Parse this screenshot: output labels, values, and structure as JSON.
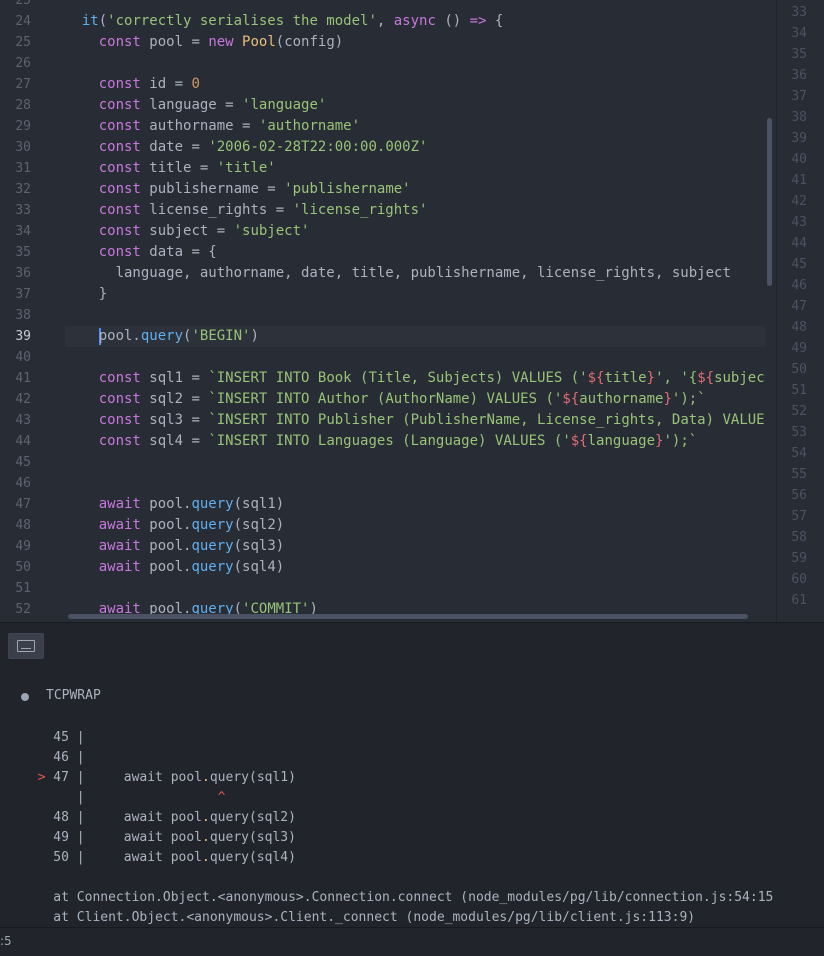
{
  "editor": {
    "gutter": [
      "25",
      "24",
      "25",
      "26",
      "27",
      "28",
      "29",
      "30",
      "31",
      "32",
      "33",
      "34",
      "35",
      "36",
      "37",
      "38",
      "39",
      "40",
      "41",
      "42",
      "43",
      "44",
      "45",
      "46",
      "47",
      "48",
      "49",
      "50",
      "51",
      "52"
    ],
    "active_line": "39",
    "lines": [
      [],
      [
        [
          "  ",
          ""
        ],
        [
          "it",
          "f"
        ],
        [
          "(",
          ""
        ],
        [
          "'correctly serialises the model'",
          "s"
        ],
        [
          ", ",
          ""
        ],
        [
          "async",
          "k"
        ],
        [
          " () ",
          ""
        ],
        [
          "=>",
          "k"
        ],
        [
          " {",
          ""
        ]
      ],
      [
        [
          "    ",
          ""
        ],
        [
          "const",
          "k"
        ],
        [
          " pool = ",
          ""
        ],
        [
          "new",
          "k"
        ],
        [
          " ",
          ""
        ],
        [
          "Pool",
          "c"
        ],
        [
          "(config)",
          ""
        ]
      ],
      [],
      [
        [
          "    ",
          ""
        ],
        [
          "const",
          "k"
        ],
        [
          " id = ",
          ""
        ],
        [
          "0",
          "n"
        ]
      ],
      [
        [
          "    ",
          ""
        ],
        [
          "const",
          "k"
        ],
        [
          " language = ",
          ""
        ],
        [
          "'language'",
          "s"
        ]
      ],
      [
        [
          "    ",
          ""
        ],
        [
          "const",
          "k"
        ],
        [
          " authorname = ",
          ""
        ],
        [
          "'authorname'",
          "s"
        ]
      ],
      [
        [
          "    ",
          ""
        ],
        [
          "const",
          "k"
        ],
        [
          " date = ",
          ""
        ],
        [
          "'2006-02-28T22:00:00.000Z'",
          "s"
        ]
      ],
      [
        [
          "    ",
          ""
        ],
        [
          "const",
          "k"
        ],
        [
          " title = ",
          ""
        ],
        [
          "'title'",
          "s"
        ]
      ],
      [
        [
          "    ",
          ""
        ],
        [
          "const",
          "k"
        ],
        [
          " publishername = ",
          ""
        ],
        [
          "'publishername'",
          "s"
        ]
      ],
      [
        [
          "    ",
          ""
        ],
        [
          "const",
          "k"
        ],
        [
          " license_rights = ",
          ""
        ],
        [
          "'license_rights'",
          "s"
        ]
      ],
      [
        [
          "    ",
          ""
        ],
        [
          "const",
          "k"
        ],
        [
          " subject = ",
          ""
        ],
        [
          "'subject'",
          "s"
        ]
      ],
      [
        [
          "    ",
          ""
        ],
        [
          "const",
          "k"
        ],
        [
          " data = {",
          ""
        ]
      ],
      [
        [
          "      language, authorname, date, title, publishername, license_rights, subject",
          ""
        ]
      ],
      [
        [
          "    }",
          ""
        ]
      ],
      [],
      [
        [
          "    ",
          ""
        ],
        [
          "|cursor|",
          "cursor"
        ],
        [
          "pool.",
          ""
        ],
        [
          "query",
          "f"
        ],
        [
          "(",
          ""
        ],
        [
          "'BEGIN'",
          "s"
        ],
        [
          ")",
          ""
        ]
      ],
      [],
      [
        [
          "    ",
          ""
        ],
        [
          "const",
          "k"
        ],
        [
          " sql1 = ",
          ""
        ],
        [
          "`INSERT INTO Book (Title, Subjects) VALUES ('",
          "s"
        ],
        [
          "${",
          "ti"
        ],
        [
          "title",
          "s"
        ],
        [
          "}",
          "ti"
        ],
        [
          "', '{",
          "s"
        ],
        [
          "${",
          "ti"
        ],
        [
          "subjec",
          "s"
        ]
      ],
      [
        [
          "    ",
          ""
        ],
        [
          "const",
          "k"
        ],
        [
          " sql2 = ",
          ""
        ],
        [
          "`INSERT INTO Author (AuthorName) VALUES ('",
          "s"
        ],
        [
          "${",
          "ti"
        ],
        [
          "authorname",
          "s"
        ],
        [
          "}",
          "ti"
        ],
        [
          "');`",
          "s"
        ]
      ],
      [
        [
          "    ",
          ""
        ],
        [
          "const",
          "k"
        ],
        [
          " sql3 = ",
          ""
        ],
        [
          "`INSERT INTO Publisher (PublisherName, License_rights, Data) VALUE",
          "s"
        ]
      ],
      [
        [
          "    ",
          ""
        ],
        [
          "const",
          "k"
        ],
        [
          " sql4 = ",
          ""
        ],
        [
          "`INSERT INTO Languages (Language) VALUES ('",
          "s"
        ],
        [
          "${",
          "ti"
        ],
        [
          "language",
          "s"
        ],
        [
          "}",
          "ti"
        ],
        [
          "');`",
          "s"
        ]
      ],
      [],
      [],
      [
        [
          "    ",
          ""
        ],
        [
          "await",
          "k"
        ],
        [
          " pool.",
          ""
        ],
        [
          "query",
          "f"
        ],
        [
          "(sql1)",
          ""
        ]
      ],
      [
        [
          "    ",
          ""
        ],
        [
          "await",
          "k"
        ],
        [
          " pool.",
          ""
        ],
        [
          "query",
          "f"
        ],
        [
          "(sql2)",
          ""
        ]
      ],
      [
        [
          "    ",
          ""
        ],
        [
          "await",
          "k"
        ],
        [
          " pool.",
          ""
        ],
        [
          "query",
          "f"
        ],
        [
          "(sql3)",
          ""
        ]
      ],
      [
        [
          "    ",
          ""
        ],
        [
          "await",
          "k"
        ],
        [
          " pool.",
          ""
        ],
        [
          "query",
          "f"
        ],
        [
          "(sql4)",
          ""
        ]
      ],
      [],
      [
        [
          "    ",
          ""
        ],
        [
          "await",
          "k"
        ],
        [
          " pool.",
          ""
        ],
        [
          "query",
          "f"
        ],
        [
          "(",
          ""
        ],
        [
          "'COMMIT'",
          "s"
        ],
        [
          ")",
          ""
        ]
      ]
    ]
  },
  "minimap_gutter": [
    "33",
    "34",
    "35",
    "36",
    "37",
    "38",
    "39",
    "40",
    "41",
    "42",
    "43",
    "44",
    "45",
    "46",
    "47",
    "48",
    "49",
    "50",
    "51",
    "52",
    "53",
    "54",
    "55",
    "56",
    "57",
    "58",
    "59",
    "60",
    "61"
  ],
  "panel": {
    "keyboard_icon": "keyboard-icon",
    "header": "TCPWRAP",
    "output": [
      [
        [
          "    45 |",
          ""
        ]
      ],
      [
        [
          "    46 |",
          ""
        ]
      ],
      [
        [
          "  ",
          ""
        ],
        [
          ">",
          "arrow"
        ],
        [
          " 47 |     await pool",
          ""
        ],
        [
          ".",
          "dotc"
        ],
        [
          "query(sql1)",
          ""
        ]
      ],
      [
        [
          "       |                 ",
          ""
        ],
        [
          "^",
          "caret"
        ]
      ],
      [
        [
          "    48 |     await pool",
          ""
        ],
        [
          ".",
          "dotc"
        ],
        [
          "query(sql2)",
          ""
        ]
      ],
      [
        [
          "    49 |     await pool",
          ""
        ],
        [
          ".",
          "dotc"
        ],
        [
          "query(sql3)",
          ""
        ]
      ],
      [
        [
          "    50 |     await pool",
          ""
        ],
        [
          ".",
          "dotc"
        ],
        [
          "query(sql4)",
          ""
        ]
      ],
      [],
      [
        [
          "    at Connection.Object.<anonymous>.Connection.connect (node_modules/pg/lib/connection.js:54:15",
          ""
        ]
      ],
      [
        [
          "    at Client.Object.<anonymous>.Client._connect (node_modules/pg/lib/client.js:113:9)",
          ""
        ]
      ]
    ]
  },
  "status": {
    "text": ":5"
  }
}
